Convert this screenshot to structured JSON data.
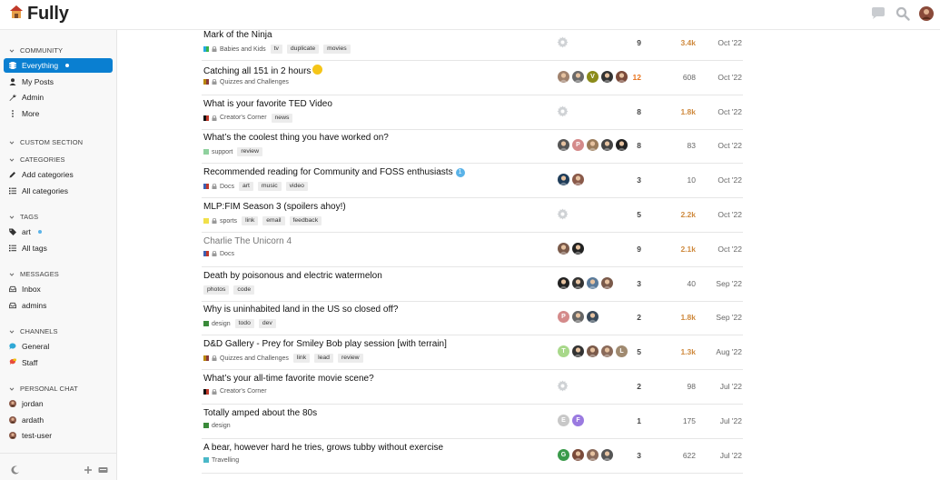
{
  "header": {
    "title": "Fully"
  },
  "sidebar": {
    "sections": [
      {
        "title": "COMMUNITY",
        "items": [
          {
            "label": "Everything",
            "icon": "stack-icon",
            "active": true,
            "dot": true
          },
          {
            "label": "My Posts",
            "icon": "user-icon"
          },
          {
            "label": "Admin",
            "icon": "wrench-icon"
          },
          {
            "label": "More",
            "icon": "ellipsis-icon"
          }
        ]
      },
      {
        "title": "CUSTOM SECTION",
        "items": []
      },
      {
        "title": "CATEGORIES",
        "items": [
          {
            "label": "Add categories",
            "icon": "pencil-icon"
          },
          {
            "label": "All categories",
            "icon": "list-icon"
          }
        ]
      },
      {
        "title": "TAGS",
        "items": [
          {
            "label": "art",
            "icon": "tag-icon",
            "dot": true
          },
          {
            "label": "All tags",
            "icon": "list-icon"
          }
        ]
      },
      {
        "title": "MESSAGES",
        "items": [
          {
            "label": "Inbox",
            "icon": "inbox-icon"
          },
          {
            "label": "admins",
            "icon": "inbox-icon"
          }
        ]
      },
      {
        "title": "CHANNELS",
        "items": [
          {
            "label": "General",
            "icon": "chat-bubble-icon"
          },
          {
            "label": "Staff",
            "icon": "staff-icon"
          }
        ]
      },
      {
        "title": "PERSONAL CHAT",
        "items": [
          {
            "label": "jordan",
            "icon": "avatar-icon"
          },
          {
            "label": "ardath",
            "icon": "avatar-icon"
          },
          {
            "label": "test-user",
            "icon": "avatar-icon"
          }
        ]
      }
    ]
  },
  "topics": [
    {
      "title": "Mark of the Ninja",
      "category": "Babies and Kids",
      "cat_colors": [
        "#25aae1",
        "#3ab54a"
      ],
      "locked": true,
      "tags": [
        "tv",
        "duplicate",
        "movies"
      ],
      "posters": [],
      "replies": "9",
      "views": "3.4k",
      "views_hot": true,
      "activity": "Oct '22"
    },
    {
      "title": "Catching all 151 in 2 hours",
      "emoji": true,
      "category": "Quizzes and Challenges",
      "cat_colors": [
        "#b8860b",
        "#8b3a3a"
      ],
      "locked": true,
      "tags": [],
      "posters": [
        {
          "c": "#a0826d",
          "t": ""
        },
        {
          "c": "#6a6a6a",
          "t": ""
        },
        {
          "c": "#8b8b1a",
          "t": "V"
        },
        {
          "c": "#333",
          "t": ""
        },
        {
          "c": "#7a4a3a",
          "t": ""
        }
      ],
      "replies": "12",
      "replies_hot": true,
      "views": "608",
      "activity": "Oct '22"
    },
    {
      "title": "What is your favorite TED Video",
      "category": "Creator's Corner",
      "cat_colors": [
        "#111",
        "#c0392b"
      ],
      "locked": true,
      "tags": [
        "news"
      ],
      "posters": [],
      "replies": "8",
      "views": "1.8k",
      "views_hot": true,
      "activity": "Oct '22"
    },
    {
      "title": "What’s the coolest thing you have worked on?",
      "category": "support",
      "cat_colors": [
        "#8fd19e",
        "#8fd19e"
      ],
      "locked": false,
      "tags": [
        "review"
      ],
      "posters": [
        {
          "c": "#555",
          "t": ""
        },
        {
          "c": "#d48a8a",
          "t": "P"
        },
        {
          "c": "#9a7b5a",
          "t": ""
        },
        {
          "c": "#444",
          "t": ""
        },
        {
          "c": "#222",
          "t": ""
        }
      ],
      "replies": "8",
      "views": "83",
      "activity": "Oct '22"
    },
    {
      "title": "Recommended reading for Community and FOSS enthusiasts",
      "badge": "1",
      "category": "Docs",
      "cat_colors": [
        "#3e5fb0",
        "#c0392b"
      ],
      "locked": true,
      "tags": [
        "art",
        "music",
        "video"
      ],
      "posters": [
        {
          "c": "#1f3d5a",
          "t": ""
        },
        {
          "c": "#8a5a4a",
          "t": ""
        }
      ],
      "replies": "3",
      "views": "10",
      "activity": "Oct '22"
    },
    {
      "title": "MLP:FIM Season 3 (spoilers ahoy!)",
      "category": "sports",
      "cat_colors": [
        "#f1e04a",
        "#f1e04a"
      ],
      "locked": true,
      "tags": [
        "link",
        "email",
        "feedback"
      ],
      "posters": [],
      "replies": "5",
      "views": "2.2k",
      "views_hot": true,
      "activity": "Oct '22"
    },
    {
      "title": "Charlie The Unicorn 4",
      "visited": true,
      "category": "Docs",
      "cat_colors": [
        "#3e5fb0",
        "#c0392b"
      ],
      "locked": true,
      "tags": [],
      "posters": [
        {
          "c": "#7a5a4a",
          "t": ""
        },
        {
          "c": "#222",
          "t": ""
        }
      ],
      "replies": "9",
      "views": "2.1k",
      "views_hot": true,
      "activity": "Oct '22"
    },
    {
      "title": "Death by poisonous and electric watermelon",
      "category": "",
      "cat_colors": [],
      "locked": false,
      "tags": [
        "photos",
        "code"
      ],
      "posters": [
        {
          "c": "#222",
          "t": ""
        },
        {
          "c": "#333",
          "t": ""
        },
        {
          "c": "#5a7a9a",
          "t": ""
        },
        {
          "c": "#7a5a4a",
          "t": ""
        }
      ],
      "replies": "3",
      "views": "40",
      "activity": "Sep '22"
    },
    {
      "title": "Why is uninhabited land in the US so closed off?",
      "category": "design",
      "cat_colors": [
        "#3a8a3a",
        "#3a8a3a"
      ],
      "locked": false,
      "tags": [
        "todo",
        "dev"
      ],
      "posters": [
        {
          "c": "#d48a8a",
          "t": "P"
        },
        {
          "c": "#666",
          "t": ""
        },
        {
          "c": "#3a4a5a",
          "t": ""
        }
      ],
      "replies": "2",
      "views": "1.8k",
      "views_hot": true,
      "activity": "Sep '22"
    },
    {
      "title": "D&D Gallery - Prey for Smiley Bob play session [with terrain]",
      "category": "Quizzes and Challenges",
      "cat_colors": [
        "#b8860b",
        "#8b3a3a"
      ],
      "locked": true,
      "tags": [
        "link",
        "lead",
        "review"
      ],
      "posters": [
        {
          "c": "#a8d88a",
          "t": "T"
        },
        {
          "c": "#333",
          "t": ""
        },
        {
          "c": "#7a5a4a",
          "t": ""
        },
        {
          "c": "#8a6a5a",
          "t": ""
        },
        {
          "c": "#a08a70",
          "t": "L"
        }
      ],
      "replies": "5",
      "views": "1.3k",
      "views_hot": true,
      "activity": "Aug '22"
    },
    {
      "title": "What’s your all-time favorite movie scene?",
      "category": "Creator's Corner",
      "cat_colors": [
        "#111",
        "#c0392b"
      ],
      "locked": true,
      "tags": [],
      "posters": [],
      "replies": "2",
      "views": "98",
      "activity": "Jul '22"
    },
    {
      "title": "Totally amped about the 80s",
      "category": "design",
      "cat_colors": [
        "#3a8a3a",
        "#3a8a3a"
      ],
      "locked": false,
      "tags": [],
      "posters": [
        {
          "c": "#c8c8c8",
          "t": "E"
        },
        {
          "c": "#9a7ae0",
          "t": "F"
        }
      ],
      "replies": "1",
      "views": "175",
      "activity": "Jul '22"
    },
    {
      "title": "A bear, however hard he tries, grows tubby without exercise",
      "category": "Travelling",
      "cat_colors": [
        "#4ab8c8",
        "#4ab8c8"
      ],
      "locked": false,
      "tags": [],
      "posters": [
        {
          "c": "#3a9a4a",
          "t": "G"
        },
        {
          "c": "#7a4a3a",
          "t": ""
        },
        {
          "c": "#8a6a5a",
          "t": ""
        },
        {
          "c": "#555",
          "t": ""
        }
      ],
      "replies": "3",
      "views": "622",
      "activity": "Jul '22"
    }
  ]
}
